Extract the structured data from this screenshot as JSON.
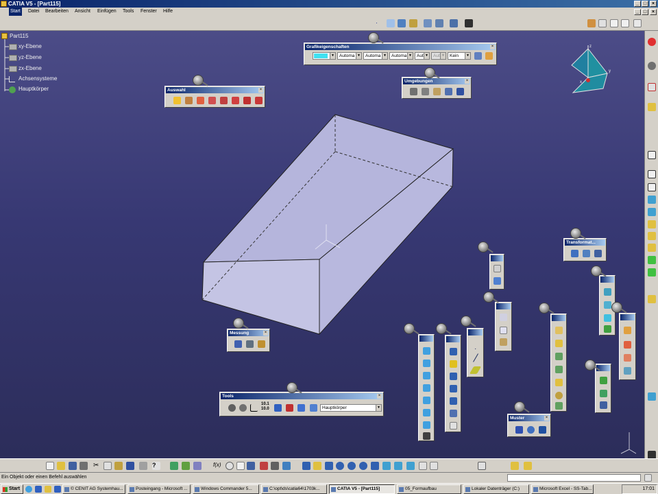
{
  "window": {
    "title": "CATIA V5 - [Part115]"
  },
  "menu": [
    {
      "label": "Start",
      "active": true
    },
    {
      "label": "Datei"
    },
    {
      "label": "Bearbeiten"
    },
    {
      "label": "Ansicht"
    },
    {
      "label": "Einfügen"
    },
    {
      "label": "Tools"
    },
    {
      "label": "Fenster"
    },
    {
      "label": "Hilfe"
    }
  ],
  "tree": {
    "root": "Part115",
    "items": [
      "xy-Ebene",
      "yz-Ebene",
      "zx-Ebene",
      "Achsensysteme",
      "Hauptkörper"
    ]
  },
  "palettes": {
    "grafik": {
      "title": "Grafikeigenschaften",
      "fill_color": "#40e0f0",
      "combo1": "Automa",
      "combo2": "Automa",
      "combo3": "Automa",
      "combo4": "Aut",
      "combo5": "Aut",
      "combo6": "Kein"
    },
    "auswahl": {
      "title": "Auswahl"
    },
    "umgebungen": {
      "title": "Umgebungen"
    },
    "messung": {
      "title": "Messung"
    },
    "tools": {
      "title": "Tools",
      "body": "Hauptkörper",
      "measure1": "10.1",
      "measure2": "10.0"
    },
    "muster": {
      "title": "Muster"
    },
    "transformat": {
      "title": "Transformat..."
    }
  },
  "status": {
    "message": "Ein Objekt oder einen Befehl auswählen"
  },
  "taskbar": {
    "start": "Start",
    "items": [
      "© CENIT AG Systemhau...",
      "Posteingang - Microsoft ...",
      "Windows Commander 5...",
      "C:\\opt\\ds\\catia64\\1703k...",
      "CATIA V5 - [Part115]",
      "05_Formaufbau",
      "Lokaler Datenträger (C:)",
      "Microsoft Excel - SS-Tab..."
    ],
    "time": "17:01"
  },
  "colors": {
    "accent": "#0a246a",
    "viewport_top": "#4c4c87",
    "viewport_bottom": "#2c2d5a",
    "part_top": "#b5b5dc",
    "part_side": "#c4c4e4"
  }
}
